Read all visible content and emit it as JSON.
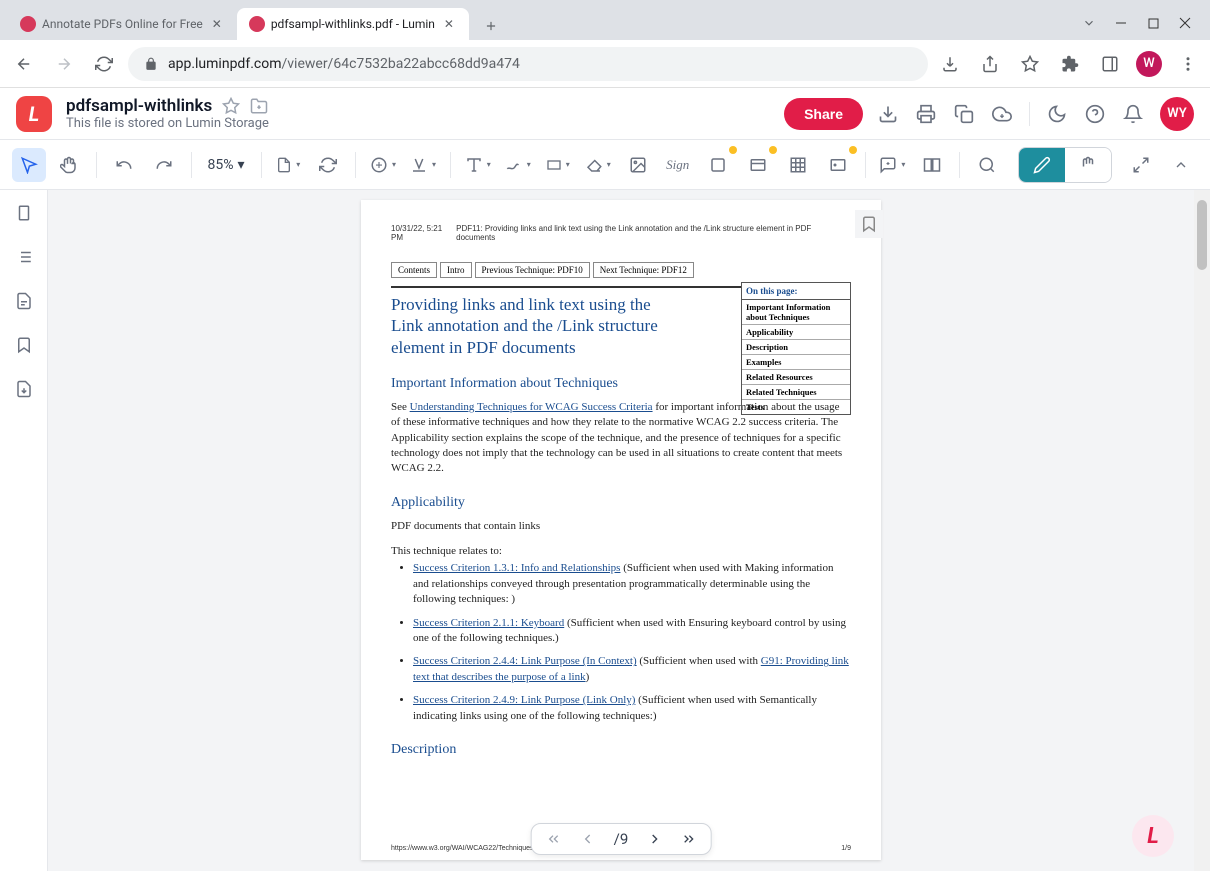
{
  "browser": {
    "tabs": [
      {
        "title": "Annotate PDFs Online for Free",
        "active": false
      },
      {
        "title": "pdfsampl-withlinks.pdf - Lumin",
        "active": true
      }
    ],
    "url_domain": "app.luminpdf.com",
    "url_path": "/viewer/64c7532ba22abcc68dd9a474",
    "profile_letter": "W"
  },
  "header": {
    "doc_title": "pdfsampl-withlinks",
    "doc_sub": "This file is stored on Lumin Storage",
    "share": "Share",
    "avatar": "WY"
  },
  "toolbar": {
    "zoom": "85%"
  },
  "pager": {
    "total": "9",
    "sep": "/"
  },
  "pdf": {
    "meta_left": "10/31/22, 5:21 PM",
    "meta_right": "PDF11: Providing links and link text using the Link annotation and the /Link structure element in PDF documents",
    "nav": [
      "Contents",
      "Intro",
      "Previous Technique: PDF10",
      "Next Technique: PDF12"
    ],
    "title": "Providing links and link text using the Link annotation and the /Link structure element in PDF documents",
    "toc_header": "On this page:",
    "toc": [
      "Important Information about Techniques",
      "Applicability",
      "Description",
      "Examples",
      "Related Resources",
      "Related Techniques",
      "Tests"
    ],
    "h_info": "Important Information about Techniques",
    "p_info_a": "See ",
    "p_info_link": "Understanding Techniques for WCAG Success Criteria",
    "p_info_b": " for important information about the usage of these informative techniques and how they relate to the normative WCAG 2.2 success criteria. The Applicability section explains the scope of the technique, and the presence of techniques for a specific technology does not imply that the technology can be used in all situations to create content that meets WCAG 2.2.",
    "h_app": "Applicability",
    "p_app1": "PDF documents that contain links",
    "p_app2": "This technique relates to:",
    "sc": [
      {
        "link": "Success Criterion 1.3.1: Info and Relationships",
        "tail": " (Sufficient when used with Making information and relationships conveyed through presentation programmatically determinable using the following techniques: )"
      },
      {
        "link": "Success Criterion 2.1.1: Keyboard",
        "tail": " (Sufficient when used with Ensuring keyboard control by using one of the following techniques.)"
      },
      {
        "link": "Success Criterion 2.4.4: Link Purpose (In Context)",
        "tail_a": " (Sufficient when used with ",
        "link2": "G91: Providing link text that describes the purpose of a link",
        "tail_b": ")"
      },
      {
        "link": "Success Criterion 2.4.9: Link Purpose (Link Only)",
        "tail": " (Sufficient when used with Semantically indicating links using one of the following techniques:)"
      }
    ],
    "h_desc": "Description",
    "footer_left": "https://www.w3.org/WAI/WCAG22/Techniques/pdf/PDF11",
    "footer_right": "1/9"
  }
}
